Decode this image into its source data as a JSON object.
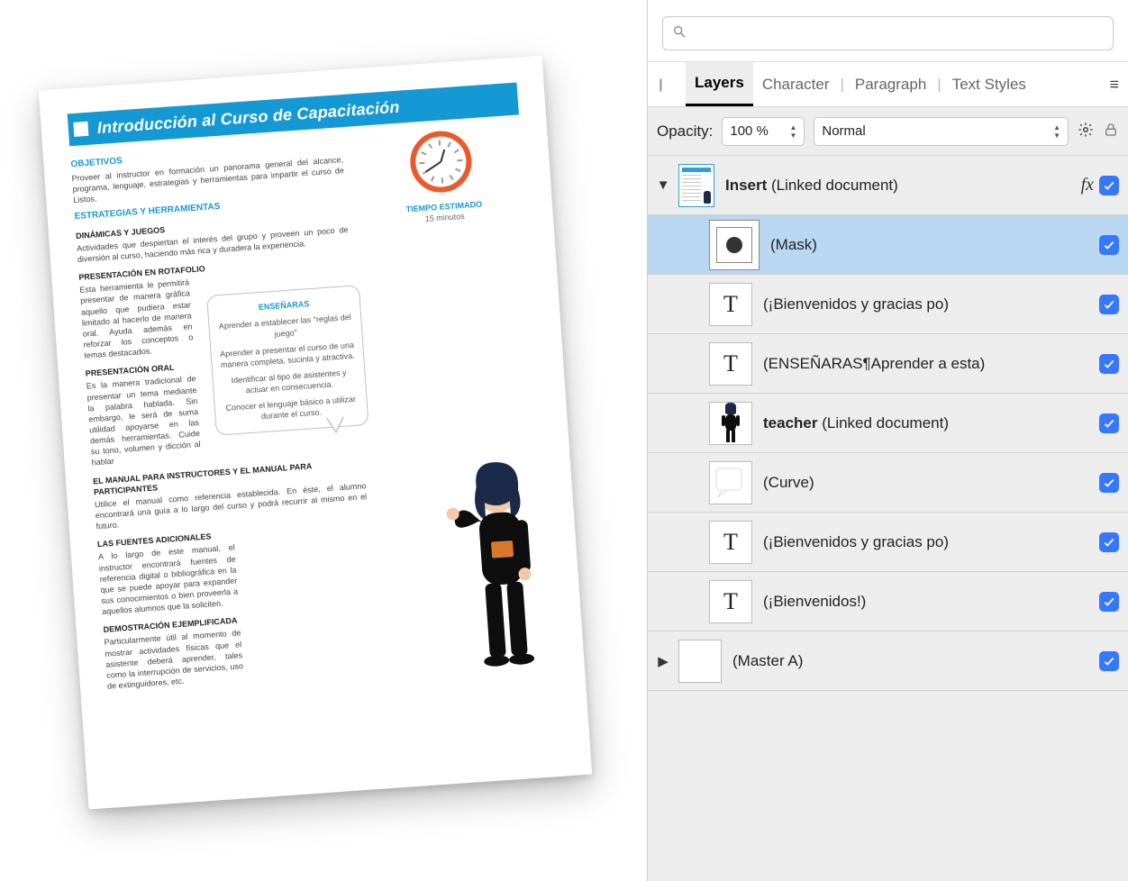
{
  "doc": {
    "title": "Introducción al Curso de Capacitación",
    "objetivos_h": "OBJETIVOS",
    "objetivos": "Proveer al instructor en formación un panorama general del alcance, programa, lenguaje, estrategias y herramientas para impartir el curso de Listos.",
    "estrategias_h": "ESTRATEGIAS Y HERRAMIENTAS",
    "s1_h": "DINÁMICAS Y JUEGOS",
    "s1": "Actividades que despiertan el interés del grupo y proveen un poco de diversión al curso, haciendo más rica y duradera la experiencia.",
    "s2_h": "PRESENTACIÓN EN ROTAFOLIO",
    "s2": "Esta herramienta le permitirá presentar de manera gráfica aquello que pudiera estar limitado al hacerlo de manera oral. Ayuda además en reforzar los conceptos o temas destacados.",
    "s3_h": "PRESENTACIÓN ORAL",
    "s3": "Es la manera tradicional de presentar un tema mediante la palabra hablada. Sin embargo, le será de suma utilidad apoyarse en las demás herramientas. Cuide su tono, volumen y dicción al hablar",
    "s4_h": "EL MANUAL PARA INSTRUCTORES Y EL MANUAL PARA PARTICIPANTES",
    "s4": "Utilice el manual como referencia establecida. En éste, el alumno encontrará una guía a lo largo del curso y podrá recurrir al mismo en el futuro.",
    "s5_h": "LAS FUENTES ADICIONALES",
    "s5": "A lo largo de este manual, el instructor encontrará fuentes de referencia digital o bibliográfica en la que se puede apoyar para expander sus conocimientos o bien proveerla a aquellos alumnos que la soliciten.",
    "s6_h": "DEMOSTRACIÓN EJEMPLIFICADA",
    "s6": "Particularmente útil al momento de mostrar actividades físicas que el asistente deberá aprender, tales como la interrupción de servicios, uso de extinguidores, etc.",
    "time_h": "TIEMPO ESTIMADO",
    "time_v": "15 minutos",
    "bubble_h": "ENSEÑARAS",
    "bubble_1": "Aprender a establecer las \"reglas del juego\"",
    "bubble_2": "Aprender a presentar el curso de una manera completa, sucinta y atractiva.",
    "bubble_3": "Identificar al tipo de asistentes y actuar en consecuencia.",
    "bubble_4": "Conocer el lenguaje básico a utilizar durante el curso."
  },
  "panel": {
    "search_placeholder": "",
    "tabs": {
      "layers": "Layers",
      "character": "Character",
      "paragraph": "Paragraph",
      "textstyles": "Text Styles"
    },
    "opacity_label": "Opacity:",
    "opacity_value": "100 %",
    "blend_mode": "Normal",
    "layers": [
      {
        "name_bold": "Insert",
        "name_rest": " (Linked document)",
        "fx": true,
        "type": "doc"
      },
      {
        "name": "(Mask)",
        "type": "mask",
        "selected": true,
        "indent": 1
      },
      {
        "name": "(¡Bienvenidos y gracias po)",
        "type": "text",
        "indent": 1
      },
      {
        "name": "(ENSEÑARAS¶Aprender a esta)",
        "type": "text",
        "indent": 1
      },
      {
        "name_bold": "teacher",
        "name_rest": " (Linked document)",
        "type": "teacher",
        "indent": 1
      },
      {
        "name": "(Curve)",
        "type": "curve",
        "indent": 1
      },
      {
        "name": "(¡Bienvenidos y gracias po)",
        "type": "text",
        "indent": 1
      },
      {
        "name": "(¡Bienvenidos!)",
        "type": "text",
        "indent": 1
      },
      {
        "name": "(Master A)",
        "type": "blank",
        "arrow": true
      }
    ]
  }
}
